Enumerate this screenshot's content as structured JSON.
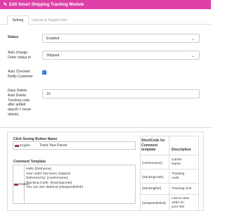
{
  "header": {
    "title": "Edit Smart Shipping Tracking Module",
    "icon": "pencil-icon",
    "bg": "#dd3fa7"
  },
  "tabs": [
    {
      "label": "Setting"
    },
    {
      "label": "License & Support Info"
    }
  ],
  "form": {
    "status_label": "Status",
    "status_value": "Enabled",
    "auto_change_label_1": "Auto change",
    "auto_change_label_2": "Order status to",
    "auto_change_value": "Shipped",
    "auto_checked_label_1": "Auto Checked",
    "auto_checked_label_2": "Notify Customer",
    "auto_checked_value": "checked",
    "days_delete_lines": [
      "Days Delete",
      "Auto Delete",
      "Tracking code",
      "after added",
      "days(0 = never",
      "delete)"
    ],
    "days_delete_value": "10"
  },
  "button_name": {
    "title": "Click Seeing Button Name",
    "language": "English",
    "value": "Track Your Parcel"
  },
  "comment_template": {
    "title": "Comment Template",
    "language": "English",
    "lines": [
      "Hello {firstname},",
      "Your order has been shipped.",
      "Delivered by: {carriername}",
      "Tracking Code: {trackingcode}",
      "You can see detail at {viewporderlink}"
    ]
  },
  "shortcode_table": {
    "header_col1": [
      "ShortCode for",
      "Comment",
      "template"
    ],
    "header_col2": "Description",
    "rows": [
      {
        "code": "{carriername}",
        "desc": [
          "Carrier",
          "Name"
        ]
      },
      {
        "code": "{trackingcode}",
        "desc": [
          "Tracking",
          "code"
        ]
      },
      {
        "code": "{trackinglink}",
        "desc": [
          "Tracking Link"
        ]
      },
      {
        "code": "{viewporderlink}",
        "desc": [
          "Link to view",
          "order on",
          "your site"
        ]
      }
    ]
  },
  "colors": {
    "accent": "#dd3fa7",
    "checkbox": "#2c6fde",
    "border": "#dddddd"
  }
}
